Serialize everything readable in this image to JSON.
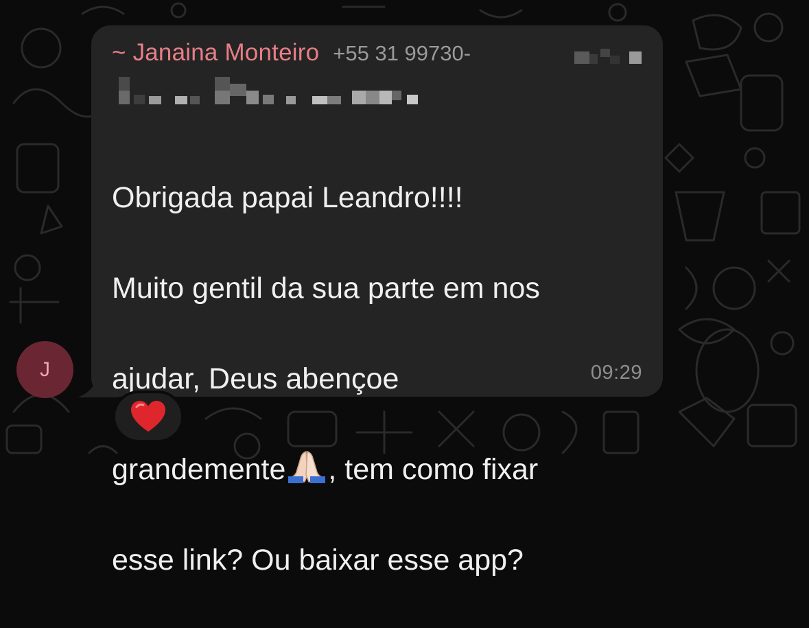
{
  "chat": {
    "avatar_initial": "J",
    "sender_name": "~ Janaina Monteiro",
    "sender_phone": "+55 31 99730-",
    "message_lines": [
      "Obrigada papai Leandro!!!!",
      "Muito gentil da sua parte em nos",
      "ajudar, Deus abençoe",
      "grandemente",
      ", tem como fixar",
      "esse link? Ou baixar esse app?"
    ],
    "timestamp": "09:29",
    "reaction_icon": "red-heart-icon",
    "emoji_icon": "folded-hands-icon"
  },
  "colors": {
    "background": "#0b0b0b",
    "bubble": "#242424",
    "sender_name": "#e87e87",
    "avatar_bg": "#6b2633",
    "heart": "#e0262d"
  }
}
